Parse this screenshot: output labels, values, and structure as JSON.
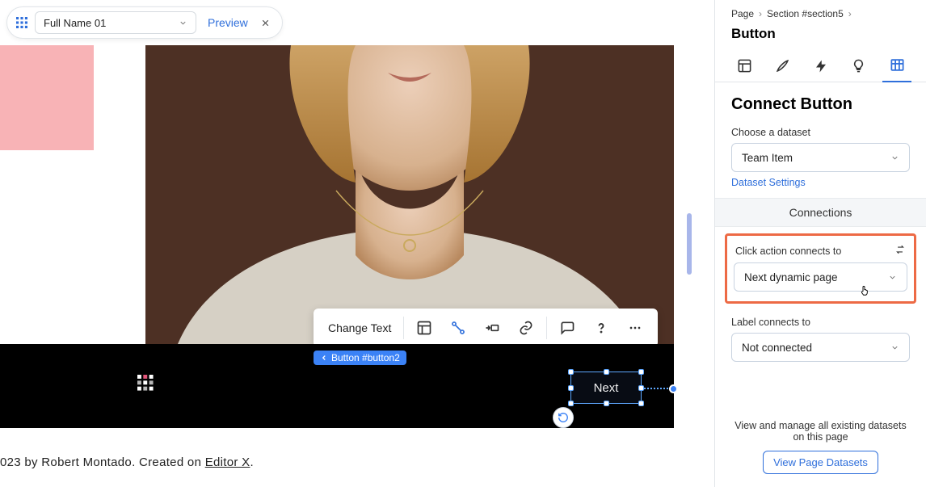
{
  "topbar": {
    "dropdown_value": "Full Name 01",
    "preview": "Preview"
  },
  "element_toolbar": {
    "change_text": "Change Text"
  },
  "selection": {
    "label": "Button #button2",
    "button_text": "Next"
  },
  "footer": {
    "prefix": "023 by Robert Montado. Created on ",
    "link": "Editor X",
    "suffix": "."
  },
  "breadcrumb": {
    "page": "Page",
    "section": "Section #section5"
  },
  "right_panel": {
    "title": "Button",
    "section_title": "Connect Button",
    "choose_dataset_label": "Choose a dataset",
    "dataset_value": "Team Item",
    "dataset_settings": "Dataset Settings",
    "connections_header": "Connections",
    "click_action_label": "Click action connects to",
    "click_action_value": "Next dynamic page",
    "label_connects_label": "Label connects to",
    "label_connects_value": "Not connected",
    "footer_msg": "View and manage all existing datasets on this page",
    "footer_btn": "View Page Datasets"
  }
}
